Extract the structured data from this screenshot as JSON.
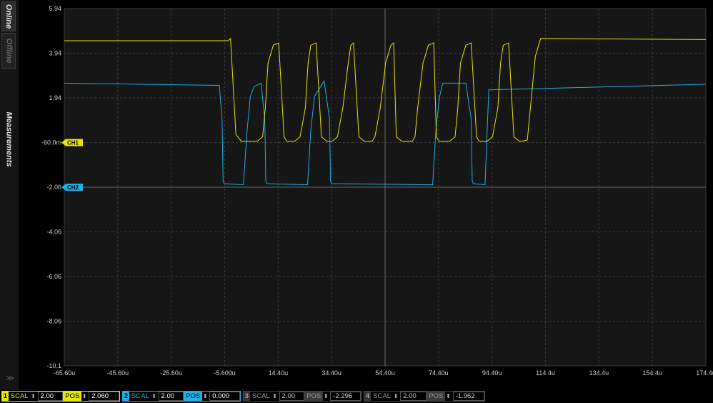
{
  "sidebar": {
    "online_label": "Online",
    "offline_label": "Offline",
    "measurements_label": "Measurements",
    "collapse_icon": "double-chevron-right-icon",
    "collapse_glyph": ">>"
  },
  "scope": {
    "colors": {
      "ch1": "#e6e600",
      "ch2": "#1ab0e8",
      "grid": "#3a3a3a",
      "background": "#161616"
    },
    "y_tick_labels": [
      "5.94",
      "3.94",
      "1.94",
      "-60.0m",
      "-2.06",
      "-4.06",
      "-6.06",
      "-8.06",
      "-10.1"
    ],
    "x_tick_labels": [
      "-65.60u",
      "-45.60u",
      "-25.60u",
      "-5.600u",
      "14.40u",
      "34.40u",
      "54.40u",
      "74.40u",
      "94.40u",
      "114.4u",
      "134.4u",
      "154.4u",
      "174.4u"
    ],
    "ch1_marker": "CH1",
    "ch2_marker": "CH2"
  },
  "chart_data": {
    "type": "line",
    "xlim": [
      -65.6,
      174.4
    ],
    "ylim": [
      -10.06,
      5.94
    ],
    "series": [
      {
        "name": "CH1",
        "x": [
          -65.6,
          -4.4,
          -3.4,
          -1.4,
          0.6,
          4.6,
          6.6,
          8.6,
          9.6,
          10.6,
          12.6,
          14.6,
          16.6,
          17.6,
          18.6,
          20.6,
          22.6,
          24.6,
          25.6,
          26.6,
          28.6,
          30.6,
          32.6,
          33.6,
          34.6,
          36.6,
          38.6,
          40.6,
          41.6,
          42.6,
          44.6,
          46.6,
          48.6,
          49.6,
          50.6,
          52.6,
          54.6,
          56.6,
          57.6,
          58.6,
          60.6,
          62.6,
          64.6,
          65.6,
          66.6,
          68.6,
          70.6,
          72.6,
          73.6,
          74.6,
          76.6,
          78.6,
          80.6,
          81.6,
          82.6,
          84.6,
          86.6,
          88.6,
          89.6,
          90.6,
          92.6,
          94.6,
          96.6,
          97.6,
          98.6,
          100.6,
          102.6,
          104.6,
          105.6,
          107.6,
          110.6,
          112.6,
          174.4
        ],
        "y": [
          4.5,
          4.5,
          4.6,
          0.3,
          0.0,
          0.0,
          0.0,
          0.2,
          1.5,
          3.5,
          4.3,
          4.4,
          0.2,
          0.0,
          0.0,
          0.0,
          0.2,
          1.5,
          3.5,
          4.3,
          4.4,
          0.2,
          0.0,
          0.0,
          0.0,
          0.2,
          1.5,
          3.5,
          4.3,
          4.4,
          0.2,
          0.0,
          0.0,
          0.0,
          0.2,
          1.5,
          3.5,
          4.3,
          4.4,
          0.2,
          0.0,
          0.0,
          0.0,
          0.2,
          1.5,
          3.5,
          4.3,
          4.4,
          0.2,
          0.0,
          0.0,
          0.0,
          0.2,
          1.5,
          3.5,
          4.3,
          4.4,
          0.2,
          0.0,
          0.0,
          0.0,
          0.2,
          1.5,
          3.5,
          4.3,
          4.4,
          0.2,
          0.0,
          0.0,
          0.05,
          3.8,
          4.6,
          4.55
        ]
      },
      {
        "name": "CH2",
        "x": [
          -65.6,
          -7.6,
          -6.6,
          -6.2,
          -5.8,
          1.4,
          2.8,
          4.0,
          5.4,
          8.0,
          9.4,
          9.8,
          10.2,
          25.4,
          26.6,
          28.0,
          31.6,
          33.6,
          34.0,
          34.4,
          72.2,
          73.4,
          74.8,
          76.0,
          78.0,
          84.6,
          86.6,
          87.0,
          87.4,
          91.8,
          92.6,
          93.2,
          174.4
        ],
        "y": [
          2.6,
          2.5,
          1.0,
          -1.8,
          -1.9,
          -1.95,
          0.5,
          2.0,
          2.45,
          2.6,
          1.0,
          -1.8,
          -1.9,
          -1.95,
          0.5,
          2.0,
          2.7,
          1.0,
          -1.8,
          -1.9,
          -1.95,
          0.5,
          2.0,
          2.6,
          2.6,
          2.6,
          1.0,
          -1.8,
          -1.9,
          -1.95,
          0.5,
          2.3,
          2.55
        ]
      }
    ]
  },
  "channels": [
    {
      "num": "1",
      "scal_label": "SCAL",
      "scal_value": "2.00",
      "pos_label": "POS",
      "pos_value": "2.060"
    },
    {
      "num": "2",
      "scal_label": "SCAL",
      "scal_value": "2.00",
      "pos_label": "POS",
      "pos_value": "0.000"
    },
    {
      "num": "3",
      "scal_label": "SCAL",
      "scal_value": "2.00",
      "pos_label": "POS",
      "pos_value": "-2.296"
    },
    {
      "num": "4",
      "scal_label": "SCAL",
      "scal_value": "2.00",
      "pos_label": "POS",
      "pos_value": "-1.962"
    }
  ],
  "stepper_arrows": "⬍"
}
